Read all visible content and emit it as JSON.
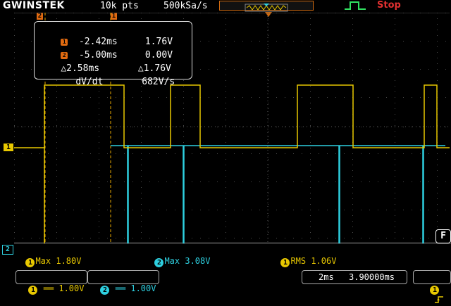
{
  "header": {
    "brand": "GWINSTEK",
    "record_length": "10k pts",
    "sample_rate": "500kSa/s",
    "run_state": "Stop"
  },
  "cursors": {
    "cursor1_tag": "1",
    "cursor2_tag": "2",
    "c1_time": "-2.42ms",
    "c1_volt": "1.76V",
    "c2_time": "-5.00ms",
    "c2_volt": "0.00V",
    "delta_time": "△2.58ms",
    "delta_volt": "△1.76V",
    "dvdt_label": "dV/dt",
    "dvdt_value": "682V/s"
  },
  "channels": {
    "ch1_marker": "1",
    "ch2_marker": "2",
    "ch1_color": "#e8c800",
    "ch2_color": "#2ed0e0"
  },
  "measurements": {
    "m1_badge": "1",
    "m1": "Max 1.80V",
    "m2_badge": "2",
    "m2": "Max 3.08V",
    "m3_badge": "1",
    "m3": "RMS 1.06V"
  },
  "footer": {
    "ch1_num": "1",
    "ch1_scale": "══ 1.00V",
    "ch2_num": "2",
    "ch2_scale": "══ 1.00V",
    "timebase": "2ms",
    "position": "3.90000ms",
    "trig_source": "1",
    "f_button": "F"
  }
}
